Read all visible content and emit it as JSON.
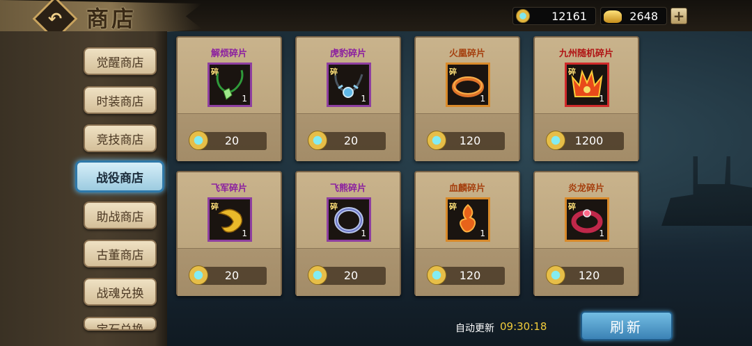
{
  "header": {
    "title": "商店",
    "currencies": [
      {
        "icon": "gem-coin-icon",
        "value": "12161"
      },
      {
        "icon": "gold-ingot-icon",
        "value": "2648"
      }
    ],
    "add_label": "+"
  },
  "sidebar": {
    "items": [
      {
        "label": "觉醒商店",
        "active": false
      },
      {
        "label": "时装商店",
        "active": false
      },
      {
        "label": "竞技商店",
        "active": false
      },
      {
        "label": "战役商店",
        "active": true
      },
      {
        "label": "助战商店",
        "active": false
      },
      {
        "label": "古董商店",
        "active": false
      },
      {
        "label": "战魂兑换",
        "active": false
      },
      {
        "label": "宝石兑换",
        "active": false
      }
    ]
  },
  "shop": {
    "tag": "碎",
    "items": [
      {
        "name": "解烦碎片",
        "qty": "1",
        "price": "20",
        "name_color": "#8b1fa0",
        "icon": "jade-necklace-icon"
      },
      {
        "name": "虎豹碎片",
        "qty": "1",
        "price": "20",
        "name_color": "#8b1fa0",
        "icon": "blue-pendant-icon"
      },
      {
        "name": "火凰碎片",
        "qty": "1",
        "price": "120",
        "name_color": "#a5400f",
        "icon": "fire-ring-icon"
      },
      {
        "name": "九州随机碎片",
        "qty": "1",
        "price": "1200",
        "name_color": "#b01414",
        "icon": "crown-emblem-icon"
      },
      {
        "name": "飞军碎片",
        "qty": "1",
        "price": "20",
        "name_color": "#8b1fa0",
        "icon": "gold-dragon-icon"
      },
      {
        "name": "飞熊碎片",
        "qty": "1",
        "price": "20",
        "name_color": "#8b1fa0",
        "icon": "silver-bracelet-icon"
      },
      {
        "name": "血麟碎片",
        "qty": "1",
        "price": "120",
        "name_color": "#a5400f",
        "icon": "flame-knot-icon"
      },
      {
        "name": "炎龙碎片",
        "qty": "1",
        "price": "120",
        "name_color": "#a5400f",
        "icon": "red-ring-icon"
      }
    ]
  },
  "footer": {
    "auto_refresh_label": "自动更新",
    "time": "09:30:18",
    "refresh_label": "刷新"
  }
}
